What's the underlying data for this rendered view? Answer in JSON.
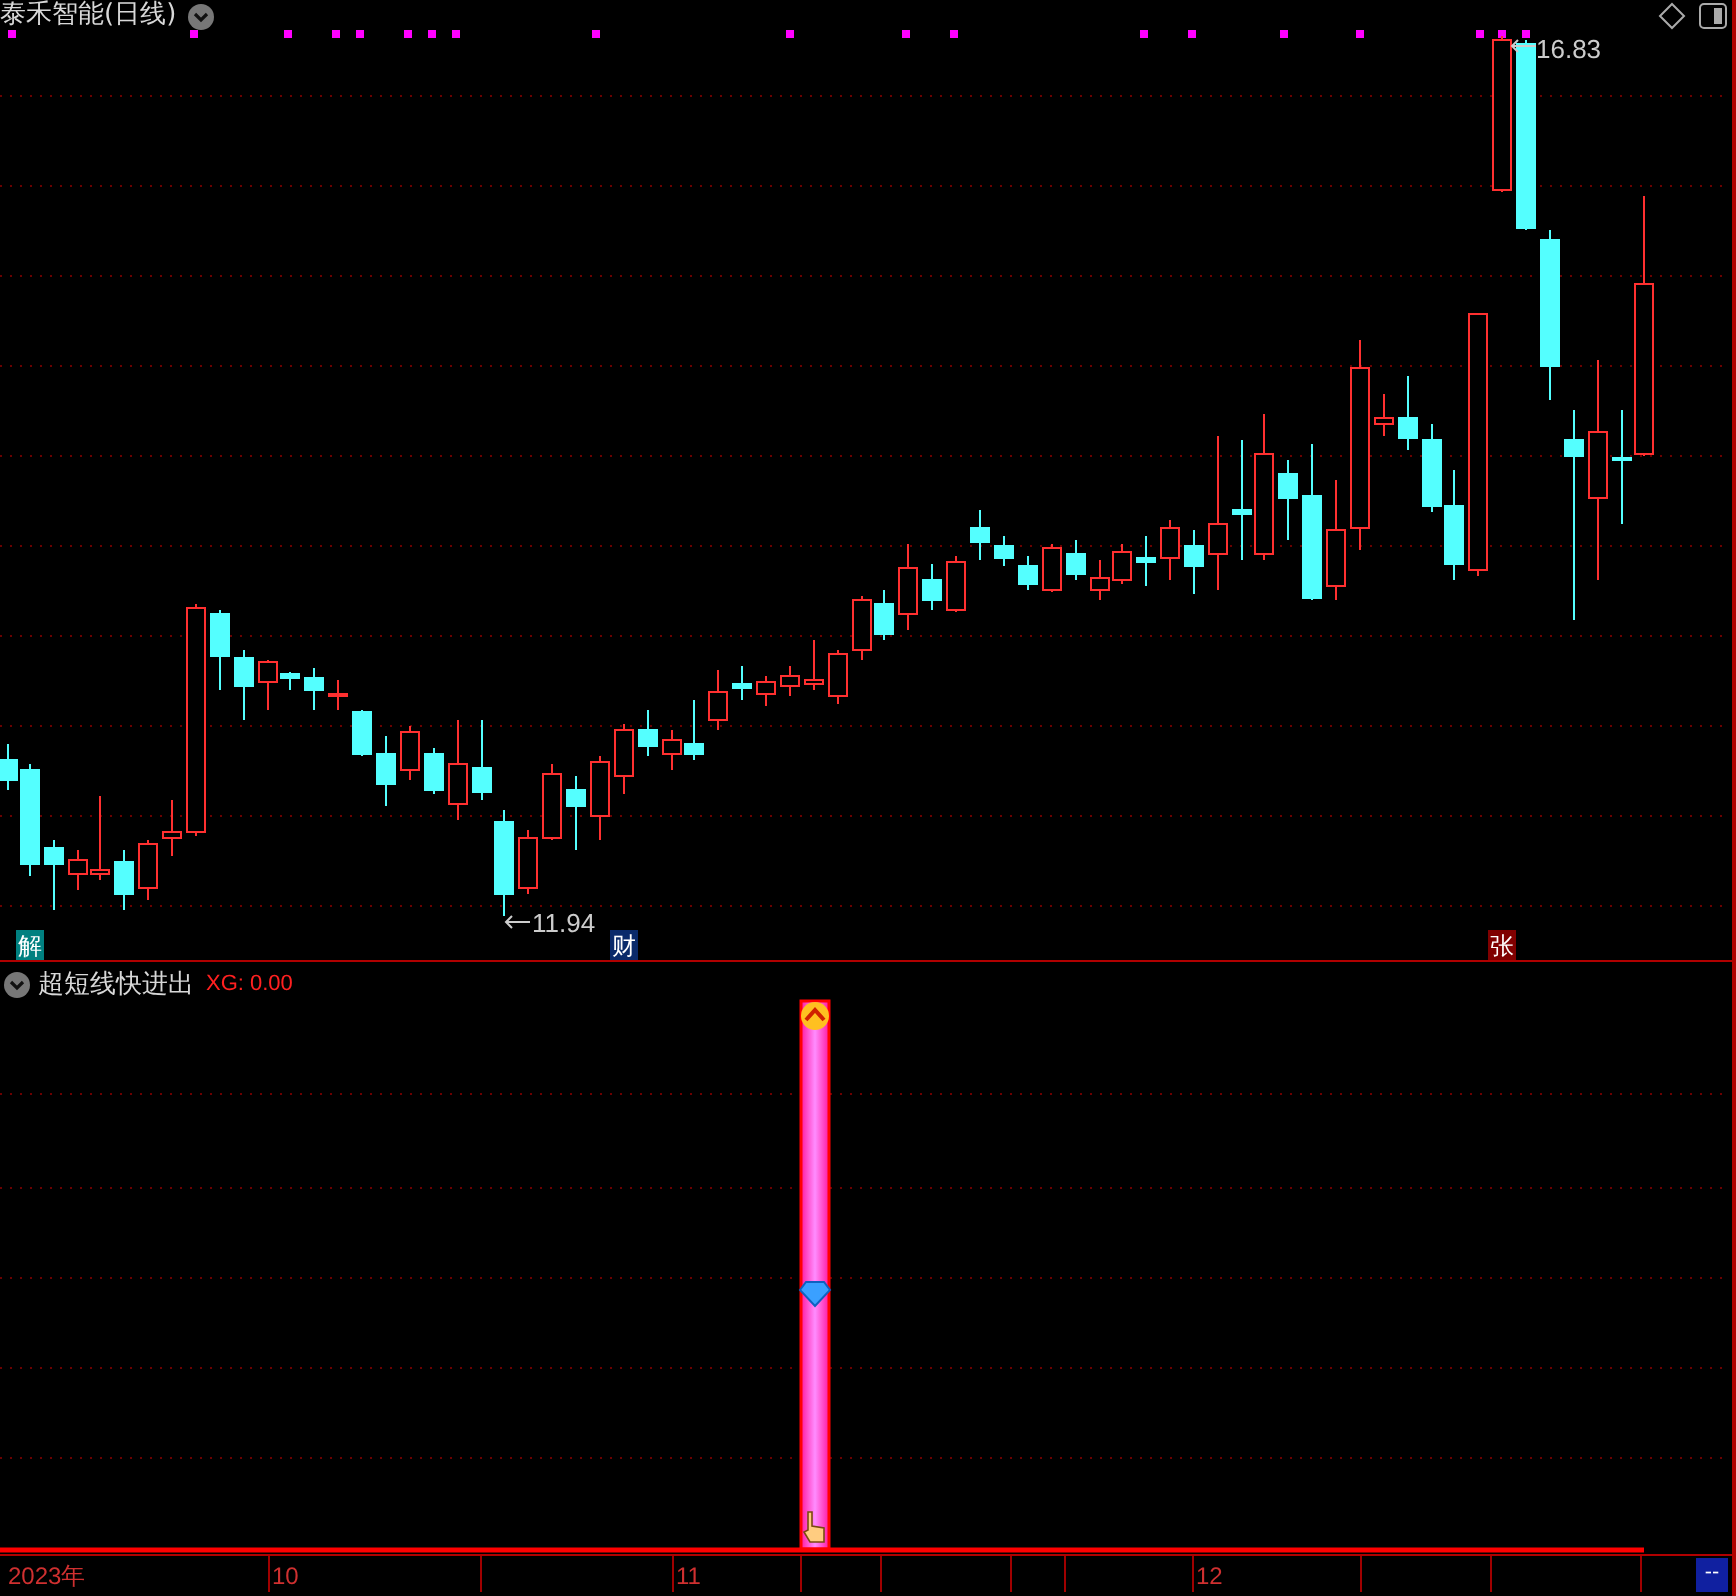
{
  "chart_header": {
    "title": "泰禾智能(日线)"
  },
  "price_marks": [
    {
      "kind": "high",
      "label": "16.83"
    },
    {
      "kind": "low",
      "label": "11.94"
    }
  ],
  "event_badges": [
    {
      "label": "解",
      "color": "#008080"
    },
    {
      "label": "财",
      "color": "#0a2a6a"
    },
    {
      "label": "张",
      "color": "#800000"
    }
  ],
  "indicator": {
    "name": "超短线快进出",
    "reading": "XG: 0.00"
  },
  "time_axis": {
    "labels": [
      "2023年",
      "10",
      "11",
      "12"
    ],
    "corner": "--"
  }
}
